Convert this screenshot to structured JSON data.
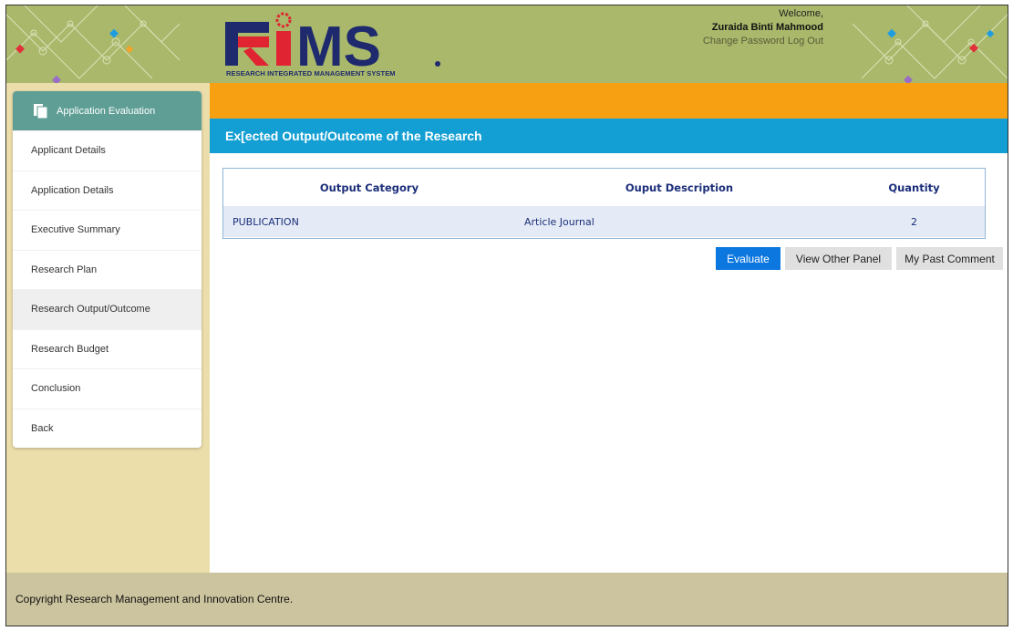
{
  "header": {
    "logo_text": "RiMS",
    "logo_tagline": "RESEARCH INTEGRATED MANAGEMENT SYSTEM",
    "welcome": "Welcome,",
    "user_name": "Zuraida Binti Mahmood",
    "change_password": "Change Password",
    "log_out": "Log Out"
  },
  "sidebar": {
    "title": "Application Evaluation",
    "items": [
      {
        "label": "Applicant Details"
      },
      {
        "label": "Application Details"
      },
      {
        "label": "Executive Summary"
      },
      {
        "label": "Research Plan"
      },
      {
        "label": "Research Output/Outcome",
        "active": true
      },
      {
        "label": "Research Budget"
      },
      {
        "label": "Conclusion"
      },
      {
        "label": "Back"
      }
    ]
  },
  "main": {
    "section_title": "Ex[ected Output/Outcome of the Research",
    "table": {
      "headers": [
        "Output Category",
        "Ouput Description",
        "Quantity"
      ],
      "rows": [
        [
          "PUBLICATION",
          "Article Journal",
          "2"
        ]
      ]
    },
    "buttons": {
      "evaluate": "Evaluate",
      "view_other_panel": "View Other Panel",
      "my_past_comment": "My Past Comment"
    }
  },
  "footer": {
    "copyright": "Copyright Research Management and Innovation Centre."
  },
  "colors": {
    "header_bg": "#a9b86a",
    "accent_orange": "#f7a012",
    "section_blue": "#139fd4",
    "sidebar_head": "#5e9e95",
    "primary_button": "#0d77e0",
    "logo_red": "#e02431",
    "logo_navy": "#1f2a6e"
  }
}
